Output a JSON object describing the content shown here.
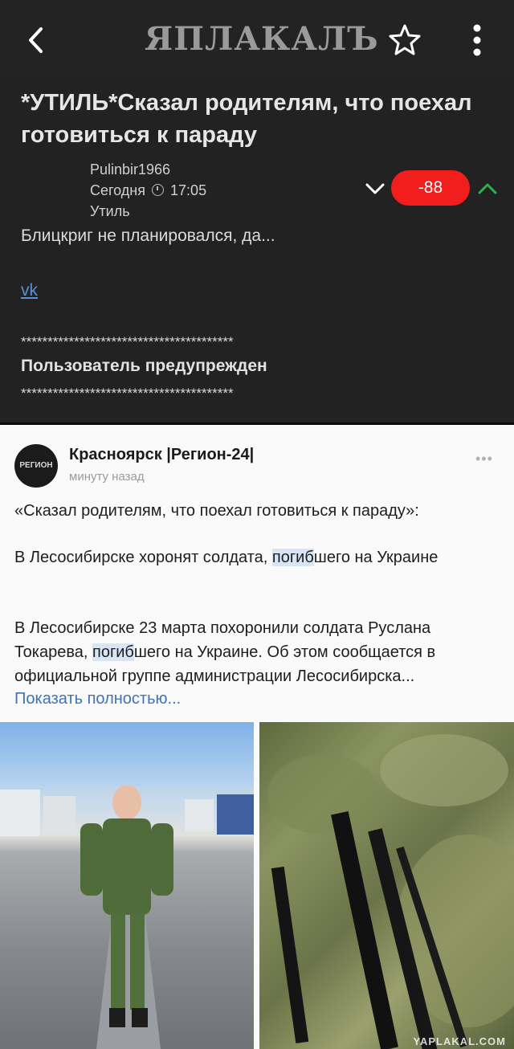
{
  "header": {
    "logo": "ЯПЛАКАЛЪ",
    "back_icon": "chevron-left-icon",
    "favorite_icon": "star-outline-icon",
    "menu_icon": "more-vertical-icon"
  },
  "post": {
    "title": "*УТИЛЬ*Сказал родителям, что поехал готовиться к параду",
    "author": "Pulinbir1966",
    "date": "Сегодня",
    "time": "17:05",
    "category": "Утиль",
    "rating": "-88",
    "rating_color": "#f21d1d",
    "upvote_color": "#2bb24c",
    "excerpt": "Блицкриг не планировался, да...",
    "source_link": "vk",
    "stars_line": "****************************************",
    "warning": "Пользователь предупрежден"
  },
  "screenshot": {
    "group_avatar": "РЕГИОН",
    "group_name": "Красноярск |Регион-24|",
    "time_ago": "минуту назад",
    "quote": "«Сказал родителям, что поехал готовиться к параду»:",
    "headline_a": " В Лесосибирске хоронят солдата, ",
    "headline_hl": "погиб",
    "headline_b": "шего на Украине",
    "body_a": "В Лесосибирске 23 марта похоронили солдата Руслана Токарева, ",
    "body_hl": "погиб",
    "body_b": "шего на Украине. Об этом сообщается в официальной группе администрации Лесосибирска...",
    "show_more": "Показать полностью...",
    "watermark": "YAPLAKAL.COM"
  }
}
